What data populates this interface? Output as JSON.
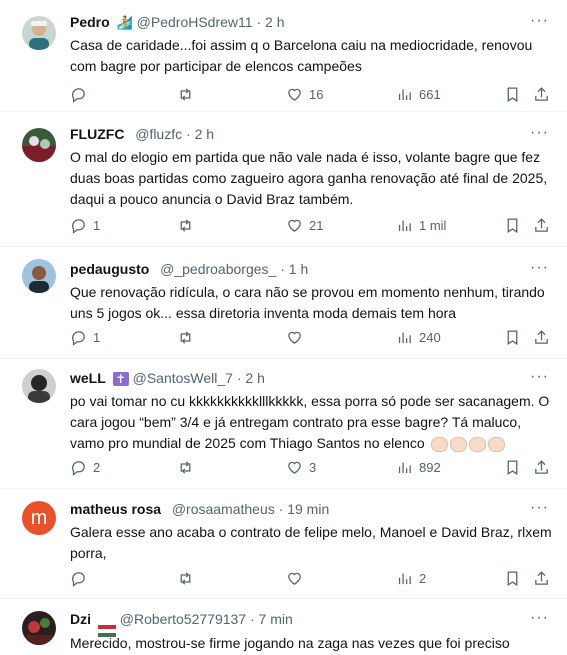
{
  "colors": {
    "text": "#0f1419",
    "muted": "#536471",
    "border": "#eff3f4",
    "avatar_m": "#e8512a"
  },
  "more_glyph": "···",
  "tweets": [
    {
      "name": "Pedro",
      "badge": "🏄",
      "handle": "@PedroHSdrew11",
      "dot": "·",
      "time": "2 h",
      "text": "Casa de caridade...foi assim q o Barcelona caiu na mediocridade, renovou com bagre por participar de elencos campeões",
      "replies": "",
      "retweets": "",
      "likes": "16",
      "views": "661",
      "avatar": "photo"
    },
    {
      "name": "FLUZFC",
      "badge": "",
      "handle": "@fluzfc",
      "dot": "·",
      "time": "2 h",
      "text": "O mal do elogio em partida que não vale nada é isso, volante bagre que fez duas boas partidas como zagueiro agora ganha renovação até final de 2025, daqui a pouco anuncia o David Braz também.",
      "replies": "1",
      "retweets": "",
      "likes": "21",
      "views": "1 mil",
      "avatar": "photo"
    },
    {
      "name": "pedaugusto",
      "badge": "",
      "handle": "@_pedroaborges_",
      "dot": "·",
      "time": "1 h",
      "text": "Que renovação ridícula, o cara não se provou em momento nenhum, tirando uns 5 jogos ok... essa diretoria inventa moda demais tem hora",
      "replies": "1",
      "retweets": "",
      "likes": "",
      "views": "240",
      "avatar": "photo"
    },
    {
      "name": "weLL",
      "badge": "✝",
      "handle": "@SantosWell_7",
      "dot": "·",
      "time": "2 h",
      "text": "po vai tomar no cu kkkkkkkkkklllkkkkk, essa porra só pode ser sacanagem. O cara jogou “bem” 3/4 e já entregam contrato pra esse bagre? Tá maluco, vamo pro mundial de 2025 com Thiago Santos no elenco",
      "emoji_count": 4,
      "replies": "2",
      "retweets": "",
      "likes": "3",
      "views": "892",
      "avatar": "photo"
    },
    {
      "name": "matheus rosa",
      "badge": "",
      "handle": "@rosaamatheus",
      "dot": "·",
      "time": "19 min",
      "text": "Galera esse ano acaba o contrato de felipe melo, Manoel e David Braz, rlxem porra,",
      "replies": "",
      "retweets": "",
      "likes": "",
      "views": "2",
      "avatar": "letter",
      "avatar_letter": "m"
    },
    {
      "name": "Dzi",
      "badge": "🇭🇺",
      "handle": "@Roberto52779137",
      "dot": "·",
      "time": "7 min",
      "text": "Merecido, mostrou-se firme jogando na zaga nas vezes que foi preciso",
      "replies": "",
      "retweets": "",
      "likes": "",
      "views": "",
      "avatar": "photo"
    }
  ]
}
